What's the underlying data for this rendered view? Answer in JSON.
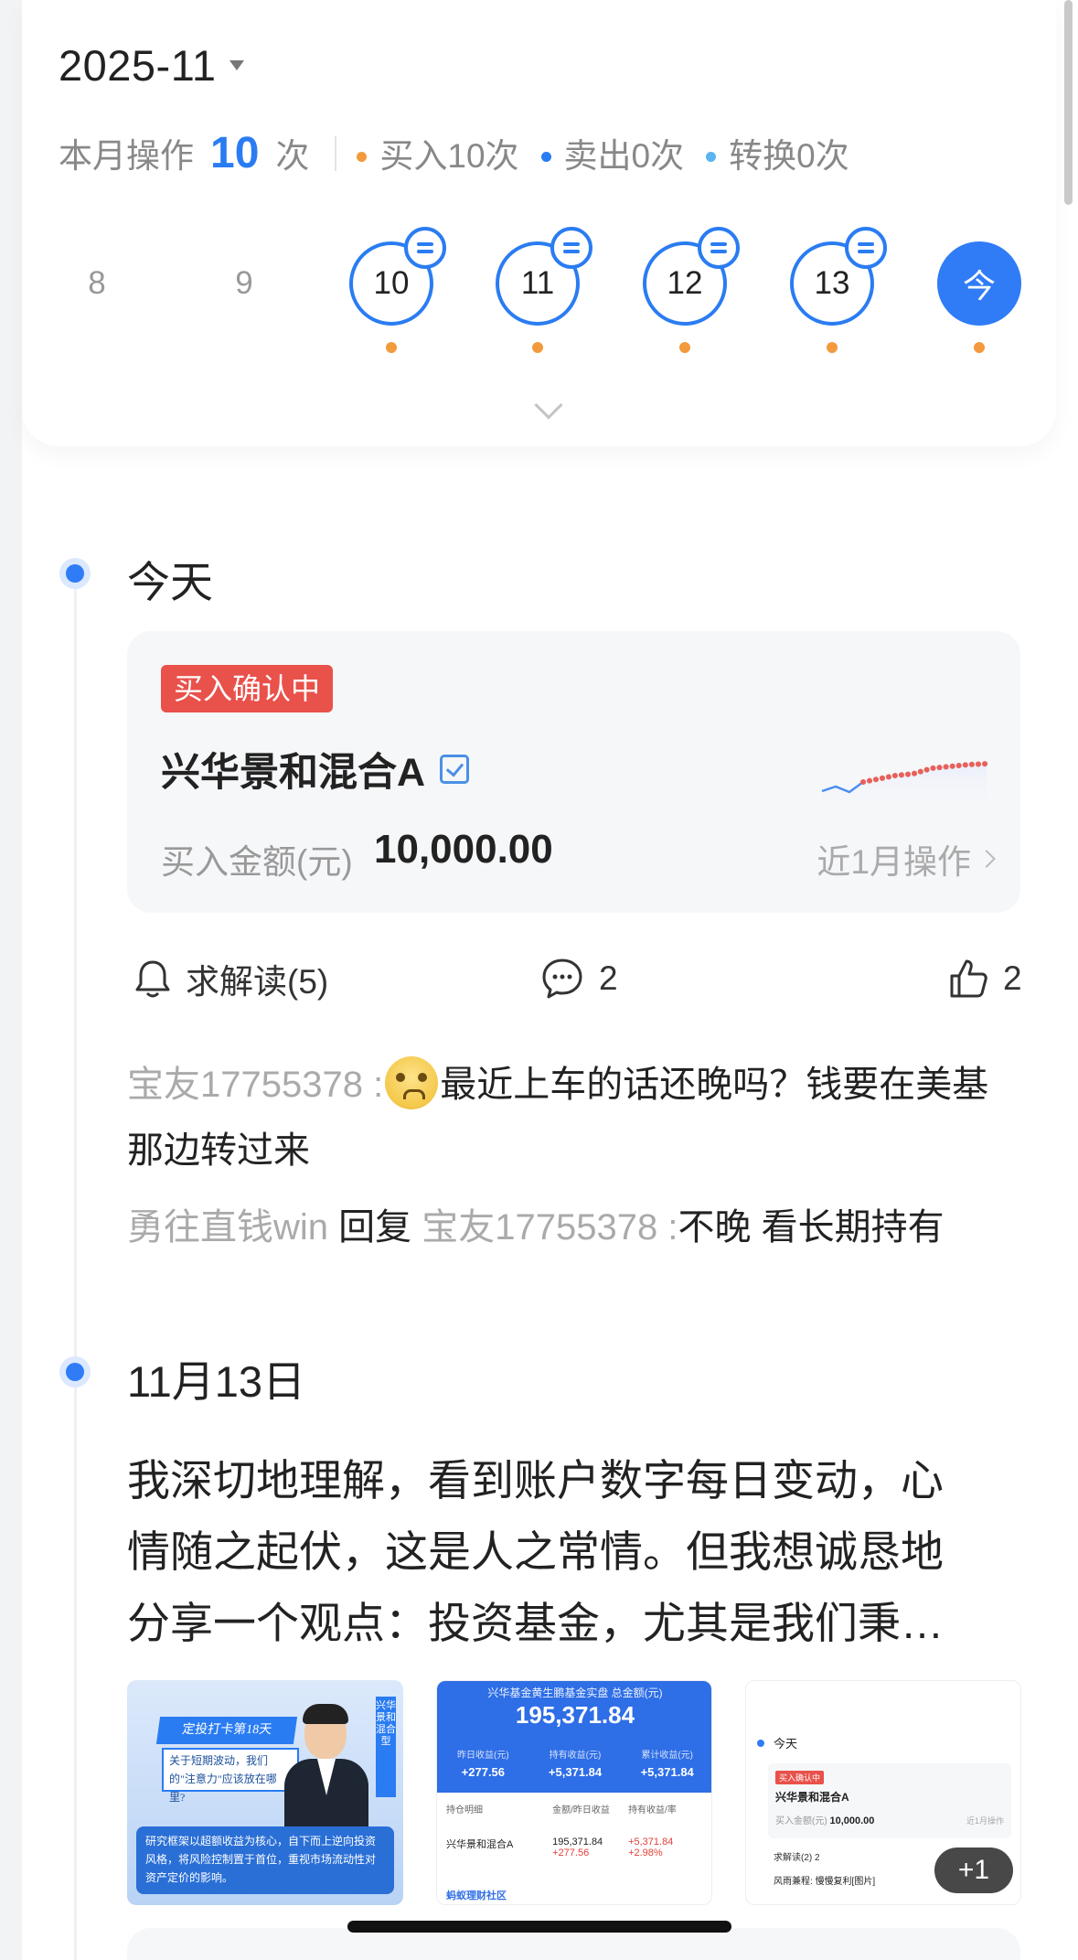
{
  "calendar": {
    "month": "2025-11",
    "stats": {
      "prefix": "本月操作",
      "count": "10",
      "suffix": "次",
      "buy": "买入10次",
      "sell": "卖出0次",
      "convert": "转换0次",
      "colors": {
        "buy": "#f39a3d",
        "sell": "#2a7cf2",
        "convert": "#5ab4f0"
      }
    },
    "days": [
      {
        "label": "8",
        "has_ops": false
      },
      {
        "label": "9",
        "has_ops": false
      },
      {
        "label": "10",
        "has_ops": true
      },
      {
        "label": "11",
        "has_ops": true
      },
      {
        "label": "12",
        "has_ops": true
      },
      {
        "label": "13",
        "has_ops": true
      },
      {
        "label": "今",
        "has_ops": true,
        "today": true
      }
    ],
    "accent_color": "#2a7cf2"
  },
  "timeline": {
    "today": {
      "title": "今天",
      "card": {
        "status": "买入确认中",
        "fund_name": "兴华景和混合A",
        "amount_label": "买入金额(元)",
        "amount_value": "10,000.00",
        "recent_link": "近1月操作"
      },
      "actions": {
        "interpret": "求解读(5)",
        "comments": "2",
        "likes": "2"
      },
      "comments": [
        {
          "user": "宝友17755378 :",
          "text": "最近上车的话还晚吗？钱要在美基那边转过来"
        },
        {
          "user": "勇往直钱win",
          "reply_word": "回复",
          "reply_to": "宝友17755378 :",
          "text": "不晚 看长期持有"
        }
      ]
    },
    "nov13": {
      "title": "11月13日",
      "post_lines": [
        "我深切地理解，看到账户数字每日变动，心",
        "情随之起伏，这是人之常情。但我想诚恳地",
        "分享一个观点：投资基金，尤其是我们秉…"
      ],
      "images": {
        "img1": {
          "banner_top": "定投打卡第18天",
          "banner_body": "关于短期波动，我们的\"注意力\"应该放在哪里?",
          "side_tag": "兴华景和混合型",
          "bottom_text": "研究框架以超额收益为核心，自下而上逆向投资风格，将风险控制置于首位，重视市场流动性对资产定价的影响。"
        },
        "img2": {
          "title": "兴华基金黄生鹏基金实盘 总金额(元)",
          "total": "195,371.84",
          "col_labels": [
            "昨日收益(元)",
            "持有收益(元)",
            "累计收益(元)"
          ],
          "col_values": [
            "+277.56",
            "+5,371.84",
            "+5,371.84"
          ],
          "table_headers": [
            "持仓明细",
            "金额/昨日收益",
            "持有收益/率"
          ],
          "row": {
            "name": "兴华景和混合A",
            "amount": "195,371.84",
            "yesterday": "+277.56",
            "hold": "+5,371.84",
            "rate": "+2.98%"
          },
          "footer": "蚂蚁理财社区"
        },
        "img3": {
          "today": "今天",
          "tag": "买入确认中",
          "name": "兴华景和混合A",
          "amount_label": "买入金额(元)",
          "amount": "10,000.00",
          "recent": "近1月操作",
          "actions": "求解读(2)    2",
          "comment_user": "风雨兼程:",
          "comment_text": "慢慢复利[图片]"
        },
        "more_count": "+1"
      }
    }
  }
}
